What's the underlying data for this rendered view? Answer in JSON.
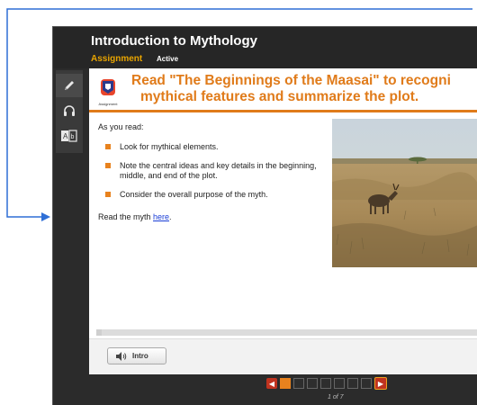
{
  "header": {
    "course_title": "Introduction to Mythology",
    "assignment_label": "Assignment",
    "status_label": "Active"
  },
  "toolbar": {
    "tools": [
      {
        "name": "pencil-icon"
      },
      {
        "name": "headphones-icon"
      },
      {
        "name": "translate-icon"
      }
    ]
  },
  "lesson": {
    "badge_label": "Assignment",
    "heading_line1": "Read \"The Beginnings of the Maasai\" to recogni",
    "heading_line2": "mythical features and summarize the plot.",
    "intro": "As you read:",
    "bullets": [
      "Look for mythical elements.",
      "Note the central ideas and key details in the beginning, middle, and end of the plot.",
      "Consider the overall purpose of the myth."
    ],
    "read_prefix": "Read the myth ",
    "read_link": "here",
    "read_suffix": "."
  },
  "footer": {
    "intro_button_label": "Intro"
  },
  "pager": {
    "current_page": 1,
    "total_pages": 7,
    "page_count_text": "1 of 7"
  },
  "colors": {
    "accent_orange": "#e07b1a",
    "assignment_gold": "#e8a400",
    "callout_blue": "#2f6fd6",
    "frame_dark": "#2b2b2b"
  }
}
